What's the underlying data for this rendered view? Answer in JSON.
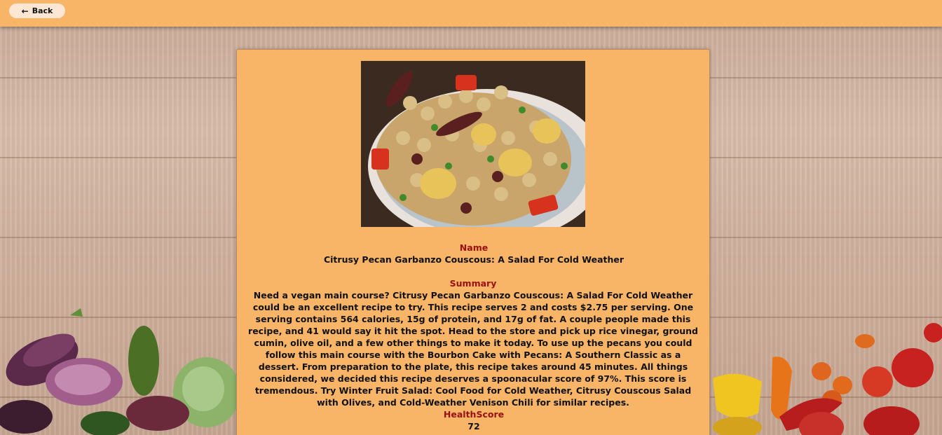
{
  "header": {
    "back_label": "Back"
  },
  "recipe": {
    "name_label": "Name",
    "name": "Citrusy Pecan Garbanzo Couscous: A Salad For Cold Weather",
    "summary_label": "Summary",
    "summary": "Need a vegan main course? Citrusy Pecan Garbanzo Couscous: A Salad For Cold Weather could be an excellent recipe to try. This recipe serves 2 and costs $2.75 per serving. One serving contains 564 calories, 15g of protein, and 17g of fat. A couple people made this recipe, and 41 would say it hit the spot. Head to the store and pick up rice vinegar, ground cumin, olive oil, and a few other things to make it today. To use up the pecans you could follow this main course with the Bourbon Cake with Pecans: A Southern Classic as a dessert. From preparation to the plate, this recipe takes around 45 minutes. All things considered, we decided this recipe deserves a spoonacular score of 97%. This score is tremendous. Try Winter Fruit Salad: Cool Food for Cold Weather, Citrusy Couscous Salad with Olives, and Cold-Weather Venison Chili for similar recipes.",
    "health_label": "HealthScore",
    "health_score": "72"
  },
  "icons": {
    "back": "arrow-left-icon"
  },
  "colors": {
    "topbar": "#f8b467",
    "card": "#f8b467",
    "label": "#9a0f0f",
    "button": "#fde6d3"
  }
}
